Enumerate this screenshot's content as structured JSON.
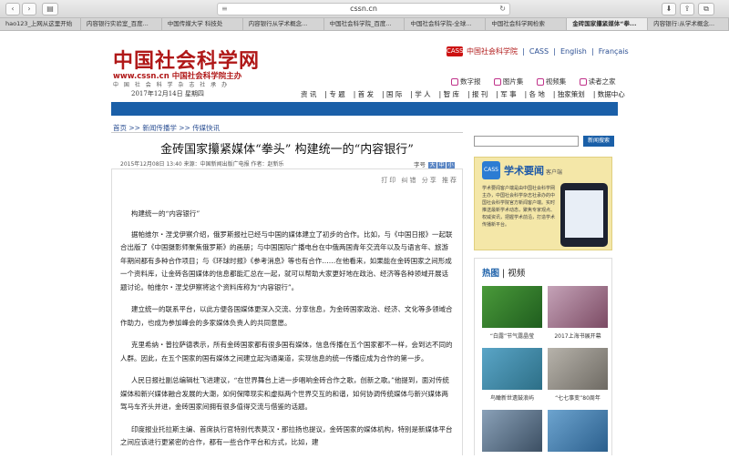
{
  "browser": {
    "url": "cssn.cn",
    "tabs": [
      "hao123_上网从这里开始",
      "内容银行实验室_百度...",
      "中国传媒大学 科技处",
      "内容银行从学术概念...",
      "中国社会科学院_百度...",
      "中国社会科学院-全球...",
      "中国社会科学网检索",
      "金砖国家攥紧媒体“拳...",
      "内容银行:从学术概念..."
    ],
    "active_tab": 7
  },
  "header": {
    "logo_cn": "中国社会科学网",
    "logo_url": "www.cssn.cn 中国社会科学院主办",
    "logo_sub": "中 国 社 会 科 学 杂 志 社 承 办",
    "date": "2017年12月14日 星期四",
    "top_links": {
      "icon": "CASS",
      "ssa": "中国社会科学院",
      "cass": "CASS",
      "english": "English",
      "francais": "Français"
    },
    "services": [
      "数字报",
      "图片集",
      "视频集",
      "读者之家"
    ],
    "nav": [
      "资 讯",
      "专 题",
      "首 发",
      "国 际",
      "学 人",
      "智 库",
      "报 刊",
      "军 事",
      "各 地",
      "独家策划",
      "数据中心"
    ]
  },
  "breadcrumb": [
    "首页",
    "新闻传播学",
    "传媒快讯"
  ],
  "article": {
    "title": "金砖国家攥紧媒体“拳头” 构建统一的“内容银行”",
    "meta": "2015年12月08日 13:40 来源：中国新闻出版广电报 作者：赵新乐",
    "fontsize_label": "字号",
    "tools": "打印 纠错 分享 推荐",
    "paragraphs": [
      "构建统一的“内容银行”",
      "据帕维尔・涅戈伊察介绍，俄罗斯报社已经与中国的媒体建立了初步的合作。比如，与《中国日报》一起联合出版了《中国摄影师聚焦俄罗斯》的画册；与中国国际广播电台在中俄两国青年交流年以及与语言年、旅游年期间都有多种合作项目；与《环球时报》《参考消息》等也有合作……在他看来，如果能在金砖国家之间形成一个资料库，让金砖各国媒体的信息都能汇总在一起，就可以帮助大家更好地在政治、经济等各种领域开展话题讨论。帕维尔・涅戈伊察将这个资料库称为“内容银行”。",
      "建立统一的联系平台，以此方便各国媒体更深入交流、分享信息，为金砖国家政治、经济、文化等多领域合作助力，也成为参加峰会的多家媒体负责人的共同意愿。",
      "克里希纳・普拉萨德表示，所有金砖国家都有很多国有媒体，信息传播在五个国家都不一样，会到达不同的人群。因此，在五个国家的国有媒体之间建立起沟通渠道，实现信息的统一传播应成为合作的第一步。",
      "人民日报社副总编辑杜飞进建议，“在世界舞台上进一步唱响金砖合作之歌，创新之歌。”他提到，面对传统媒体和新兴媒体融合发展的大潮，如何保障现实和虚拟两个世界交互的和谐，如何协调传统媒体与新兴媒体两驾马车齐头并进，金砖国家间拥有很多值得交流与借鉴的话题。",
      "印度报业托拉斯主编、首席执行官特别代表莫汉・那拉扬也提议，金砖国家的媒体机构，特别是新媒体平台之间应该进行更紧密的合作，都有一些合作平台和方式，比如，建"
    ]
  },
  "sidebar": {
    "search_button": "新闻搜索",
    "promo_app": "CASS",
    "promo_title": "学术要闻",
    "promo_sub": "客户端",
    "promo_text": "学术要闻客户端是由中国社会科学网主办，中国社会科学杂志社承办的中国社会科学院官方新闻客户端。实时推送最新学术动态，聚焦专家观点、权威资讯，把握学术前沿，打造学术传播新平台。",
    "hot_label": "热图",
    "video_label": "视频",
    "thumbs": [
      {
        "caption": "“白露”节气露晶莹",
        "color1": "#4a9a3a",
        "color2": "#1f5d1e"
      },
      {
        "caption": "2017上海书展开幕",
        "color1": "#c5a3b8",
        "color2": "#7b4a63"
      },
      {
        "caption": "鸟瞰新世遗鼓浪屿",
        "color1": "#5aa5c7",
        "color2": "#2d6f87"
      },
      {
        "caption": "“七七事变”80周年",
        "color1": "#b7b3ab",
        "color2": "#6e6a63"
      },
      {
        "caption": "",
        "color1": "#8aa1b8",
        "color2": "#3c4f63"
      },
      {
        "caption": "",
        "color1": "#6da4cf",
        "color2": "#2b5f8d"
      }
    ]
  }
}
